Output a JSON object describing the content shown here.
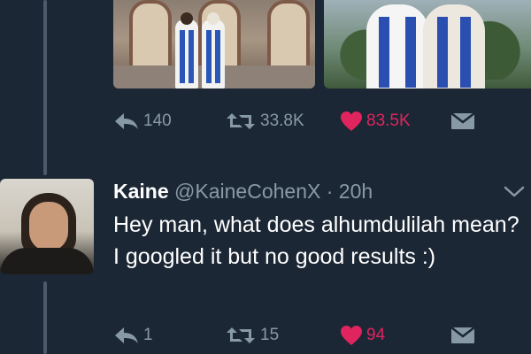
{
  "previous_tweet": {
    "actions": {
      "reply_count": "140",
      "retweet_count": "33.8K",
      "like_count": "83.5K"
    }
  },
  "reply_tweet": {
    "display_name": "Kaine",
    "handle": "@KaineCohenX",
    "separator": "·",
    "timestamp": "20h",
    "text": "Hey man, what does alhumdulilah mean? I googled it but no good results :)",
    "actions": {
      "reply_count": "1",
      "retweet_count": "15",
      "like_count": "94"
    }
  },
  "colors": {
    "background": "#1c2735",
    "icon_gray": "#8899a6",
    "like_red": "#e0245e",
    "thread_line": "#4b5968"
  },
  "icons": [
    "reply-icon",
    "retweet-icon",
    "heart-icon",
    "direct-message-icon",
    "chevron-down-icon"
  ]
}
